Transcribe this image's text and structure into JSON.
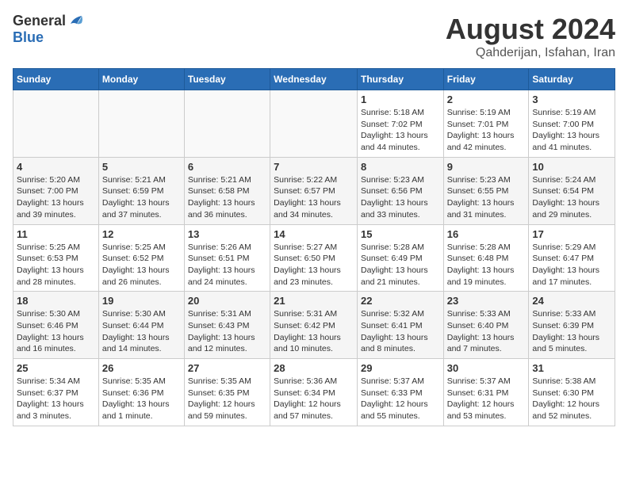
{
  "header": {
    "logo_line1": "General",
    "logo_line2": "Blue",
    "month_year": "August 2024",
    "location": "Qahderijan, Isfahan, Iran"
  },
  "weekdays": [
    "Sunday",
    "Monday",
    "Tuesday",
    "Wednesday",
    "Thursday",
    "Friday",
    "Saturday"
  ],
  "weeks": [
    [
      {
        "day": "",
        "info": ""
      },
      {
        "day": "",
        "info": ""
      },
      {
        "day": "",
        "info": ""
      },
      {
        "day": "",
        "info": ""
      },
      {
        "day": "1",
        "info": "Sunrise: 5:18 AM\nSunset: 7:02 PM\nDaylight: 13 hours\nand 44 minutes."
      },
      {
        "day": "2",
        "info": "Sunrise: 5:19 AM\nSunset: 7:01 PM\nDaylight: 13 hours\nand 42 minutes."
      },
      {
        "day": "3",
        "info": "Sunrise: 5:19 AM\nSunset: 7:00 PM\nDaylight: 13 hours\nand 41 minutes."
      }
    ],
    [
      {
        "day": "4",
        "info": "Sunrise: 5:20 AM\nSunset: 7:00 PM\nDaylight: 13 hours\nand 39 minutes."
      },
      {
        "day": "5",
        "info": "Sunrise: 5:21 AM\nSunset: 6:59 PM\nDaylight: 13 hours\nand 37 minutes."
      },
      {
        "day": "6",
        "info": "Sunrise: 5:21 AM\nSunset: 6:58 PM\nDaylight: 13 hours\nand 36 minutes."
      },
      {
        "day": "7",
        "info": "Sunrise: 5:22 AM\nSunset: 6:57 PM\nDaylight: 13 hours\nand 34 minutes."
      },
      {
        "day": "8",
        "info": "Sunrise: 5:23 AM\nSunset: 6:56 PM\nDaylight: 13 hours\nand 33 minutes."
      },
      {
        "day": "9",
        "info": "Sunrise: 5:23 AM\nSunset: 6:55 PM\nDaylight: 13 hours\nand 31 minutes."
      },
      {
        "day": "10",
        "info": "Sunrise: 5:24 AM\nSunset: 6:54 PM\nDaylight: 13 hours\nand 29 minutes."
      }
    ],
    [
      {
        "day": "11",
        "info": "Sunrise: 5:25 AM\nSunset: 6:53 PM\nDaylight: 13 hours\nand 28 minutes."
      },
      {
        "day": "12",
        "info": "Sunrise: 5:25 AM\nSunset: 6:52 PM\nDaylight: 13 hours\nand 26 minutes."
      },
      {
        "day": "13",
        "info": "Sunrise: 5:26 AM\nSunset: 6:51 PM\nDaylight: 13 hours\nand 24 minutes."
      },
      {
        "day": "14",
        "info": "Sunrise: 5:27 AM\nSunset: 6:50 PM\nDaylight: 13 hours\nand 23 minutes."
      },
      {
        "day": "15",
        "info": "Sunrise: 5:28 AM\nSunset: 6:49 PM\nDaylight: 13 hours\nand 21 minutes."
      },
      {
        "day": "16",
        "info": "Sunrise: 5:28 AM\nSunset: 6:48 PM\nDaylight: 13 hours\nand 19 minutes."
      },
      {
        "day": "17",
        "info": "Sunrise: 5:29 AM\nSunset: 6:47 PM\nDaylight: 13 hours\nand 17 minutes."
      }
    ],
    [
      {
        "day": "18",
        "info": "Sunrise: 5:30 AM\nSunset: 6:46 PM\nDaylight: 13 hours\nand 16 minutes."
      },
      {
        "day": "19",
        "info": "Sunrise: 5:30 AM\nSunset: 6:44 PM\nDaylight: 13 hours\nand 14 minutes."
      },
      {
        "day": "20",
        "info": "Sunrise: 5:31 AM\nSunset: 6:43 PM\nDaylight: 13 hours\nand 12 minutes."
      },
      {
        "day": "21",
        "info": "Sunrise: 5:31 AM\nSunset: 6:42 PM\nDaylight: 13 hours\nand 10 minutes."
      },
      {
        "day": "22",
        "info": "Sunrise: 5:32 AM\nSunset: 6:41 PM\nDaylight: 13 hours\nand 8 minutes."
      },
      {
        "day": "23",
        "info": "Sunrise: 5:33 AM\nSunset: 6:40 PM\nDaylight: 13 hours\nand 7 minutes."
      },
      {
        "day": "24",
        "info": "Sunrise: 5:33 AM\nSunset: 6:39 PM\nDaylight: 13 hours\nand 5 minutes."
      }
    ],
    [
      {
        "day": "25",
        "info": "Sunrise: 5:34 AM\nSunset: 6:37 PM\nDaylight: 13 hours\nand 3 minutes."
      },
      {
        "day": "26",
        "info": "Sunrise: 5:35 AM\nSunset: 6:36 PM\nDaylight: 13 hours\nand 1 minute."
      },
      {
        "day": "27",
        "info": "Sunrise: 5:35 AM\nSunset: 6:35 PM\nDaylight: 12 hours\nand 59 minutes."
      },
      {
        "day": "28",
        "info": "Sunrise: 5:36 AM\nSunset: 6:34 PM\nDaylight: 12 hours\nand 57 minutes."
      },
      {
        "day": "29",
        "info": "Sunrise: 5:37 AM\nSunset: 6:33 PM\nDaylight: 12 hours\nand 55 minutes."
      },
      {
        "day": "30",
        "info": "Sunrise: 5:37 AM\nSunset: 6:31 PM\nDaylight: 12 hours\nand 53 minutes."
      },
      {
        "day": "31",
        "info": "Sunrise: 5:38 AM\nSunset: 6:30 PM\nDaylight: 12 hours\nand 52 minutes."
      }
    ]
  ]
}
